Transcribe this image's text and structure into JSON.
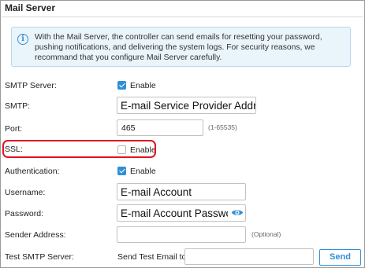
{
  "section": {
    "title": "Mail Server",
    "info_text": "With the Mail Server, the controller can send emails for resetting your password, pushing notifications, and delivering the system logs. For security reasons, we recommand that you configure Mail Server carefully."
  },
  "form": {
    "smtp_server": {
      "label": "SMTP Server:",
      "checkbox_label": "Enable",
      "checked": true
    },
    "smtp": {
      "label": "SMTP:",
      "value": "E-mail Service Provider Address"
    },
    "port": {
      "label": "Port:",
      "value": "465",
      "hint": "(1-65535)"
    },
    "ssl": {
      "label": "SSL:",
      "checkbox_label": "Enable",
      "checked": false
    },
    "authentication": {
      "label": "Authentication:",
      "checkbox_label": "Enable",
      "checked": true
    },
    "username": {
      "label": "Username:",
      "value": "E-mail Account"
    },
    "password": {
      "label": "Password:",
      "value": "E-mail Account Password",
      "icon": "eye-icon"
    },
    "sender_address": {
      "label": "Sender Address:",
      "value": "",
      "hint": "(Optional)"
    },
    "test_smtp": {
      "label": "Test SMTP Server:",
      "send_to_label": "Send Test Email to",
      "value": "",
      "button_label": "Send"
    }
  },
  "colors": {
    "accent": "#2f8fd6",
    "highlight_ring": "#e0141e",
    "info_background": "#eaf4fb"
  }
}
